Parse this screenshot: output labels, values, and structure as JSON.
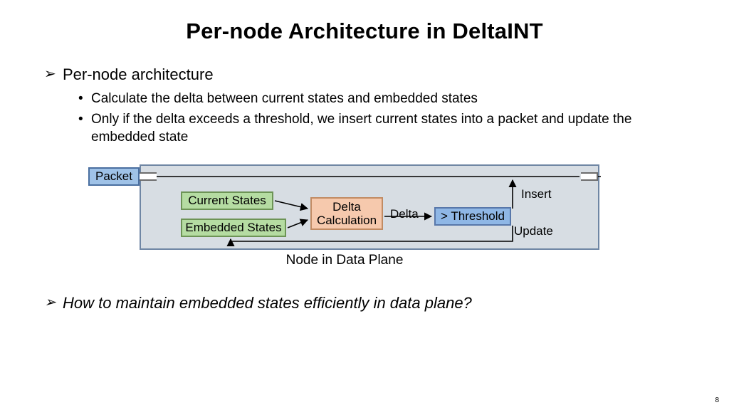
{
  "title": "Per-node Architecture in DeltaINT",
  "bullets": {
    "l1a": "Per-node architecture",
    "l2a": "Calculate the delta between current states and embedded states",
    "l2b": "Only if the delta exceeds a threshold, we insert current states into a packet and update the embedded state",
    "l1b": "How to maintain embedded states efficiently in data plane?"
  },
  "diagram": {
    "packet": "Packet",
    "current_states": "Current States",
    "embedded_states": "Embedded States",
    "delta_calc": "Delta Calculation",
    "threshold": "> Threshold",
    "label_delta": "Delta",
    "label_insert": "Insert",
    "label_update": "Update",
    "caption": "Node in Data Plane"
  },
  "page": "8"
}
